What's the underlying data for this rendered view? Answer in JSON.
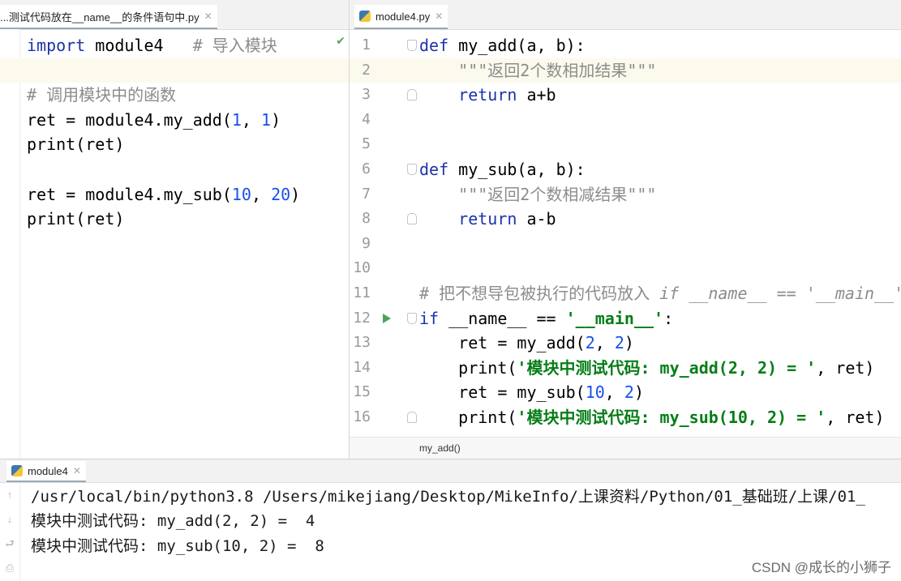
{
  "left_editor": {
    "tab_label": "...测试代码放在__name__的条件语句中.py",
    "lines": [
      {
        "parts": [
          {
            "t": "import",
            "c": "kw"
          },
          {
            "t": " module4   ",
            "c": "fn"
          },
          {
            "t": "# 导入模块",
            "c": "cm"
          }
        ]
      },
      {
        "parts": [],
        "current": true
      },
      {
        "parts": [
          {
            "t": "# 调用模块中的函数",
            "c": "cm"
          }
        ]
      },
      {
        "parts": [
          {
            "t": "ret = module4.my_add(",
            "c": "fn"
          },
          {
            "t": "1",
            "c": "num"
          },
          {
            "t": ", ",
            "c": "fn"
          },
          {
            "t": "1",
            "c": "num"
          },
          {
            "t": ")",
            "c": "fn"
          }
        ]
      },
      {
        "parts": [
          {
            "t": "print",
            "c": "fn"
          },
          {
            "t": "(ret)",
            "c": "fn"
          }
        ]
      },
      {
        "parts": []
      },
      {
        "parts": [
          {
            "t": "ret = module4.my_sub(",
            "c": "fn"
          },
          {
            "t": "10",
            "c": "num"
          },
          {
            "t": ", ",
            "c": "fn"
          },
          {
            "t": "20",
            "c": "num"
          },
          {
            "t": ")",
            "c": "fn"
          }
        ]
      },
      {
        "parts": [
          {
            "t": "print",
            "c": "fn"
          },
          {
            "t": "(ret)",
            "c": "fn"
          }
        ]
      }
    ]
  },
  "right_editor": {
    "tab_label": "module4.py",
    "breadcrumb": "my_add()",
    "lines": [
      {
        "n": "1",
        "fold": "start",
        "parts": [
          {
            "t": "def",
            "c": "kw"
          },
          {
            "t": " my_add(a, b):",
            "c": "fn"
          }
        ]
      },
      {
        "n": "2",
        "current": true,
        "parts": [
          {
            "t": "    ",
            "c": "fn"
          },
          {
            "t": "\"\"\"返回2个数相加结果\"\"\"",
            "c": "doc"
          }
        ]
      },
      {
        "n": "3",
        "fold": "end",
        "parts": [
          {
            "t": "    ",
            "c": "fn"
          },
          {
            "t": "return",
            "c": "kw"
          },
          {
            "t": " a+b",
            "c": "fn"
          }
        ]
      },
      {
        "n": "4",
        "parts": []
      },
      {
        "n": "5",
        "parts": []
      },
      {
        "n": "6",
        "fold": "start",
        "parts": [
          {
            "t": "def",
            "c": "kw"
          },
          {
            "t": " my_sub(a, b):",
            "c": "fn"
          }
        ]
      },
      {
        "n": "7",
        "parts": [
          {
            "t": "    ",
            "c": "fn"
          },
          {
            "t": "\"\"\"返回2个数相减结果\"\"\"",
            "c": "doc"
          }
        ]
      },
      {
        "n": "8",
        "fold": "end",
        "parts": [
          {
            "t": "    ",
            "c": "fn"
          },
          {
            "t": "return",
            "c": "kw"
          },
          {
            "t": " a-b",
            "c": "fn"
          }
        ]
      },
      {
        "n": "9",
        "parts": []
      },
      {
        "n": "10",
        "parts": []
      },
      {
        "n": "11",
        "parts": [
          {
            "t": "# 把不想导包被执行的代码放入 ",
            "c": "cm"
          },
          {
            "t": "if __name__ == '__main__'",
            "c": "cm-i"
          }
        ]
      },
      {
        "n": "12",
        "run": true,
        "fold": "start",
        "parts": [
          {
            "t": "if",
            "c": "kw"
          },
          {
            "t": " __name__ == ",
            "c": "fn"
          },
          {
            "t": "'__main__'",
            "c": "str"
          },
          {
            "t": ":",
            "c": "fn"
          }
        ]
      },
      {
        "n": "13",
        "parts": [
          {
            "t": "    ret = my_add(",
            "c": "fn"
          },
          {
            "t": "2",
            "c": "num"
          },
          {
            "t": ", ",
            "c": "fn"
          },
          {
            "t": "2",
            "c": "num"
          },
          {
            "t": ")",
            "c": "fn"
          }
        ]
      },
      {
        "n": "14",
        "parts": [
          {
            "t": "    print(",
            "c": "fn"
          },
          {
            "t": "'模块中测试代码: my_add(2, 2) = '",
            "c": "str"
          },
          {
            "t": ", ret)",
            "c": "fn"
          }
        ]
      },
      {
        "n": "15",
        "parts": [
          {
            "t": "    ret = my_sub(",
            "c": "fn"
          },
          {
            "t": "10",
            "c": "num"
          },
          {
            "t": ", ",
            "c": "fn"
          },
          {
            "t": "2",
            "c": "num"
          },
          {
            "t": ")",
            "c": "fn"
          }
        ]
      },
      {
        "n": "16",
        "fold": "end",
        "parts": [
          {
            "t": "    print(",
            "c": "fn"
          },
          {
            "t": "'模块中测试代码: my_sub(10, 2) = '",
            "c": "str"
          },
          {
            "t": ", ret)",
            "c": "fn"
          }
        ]
      }
    ]
  },
  "run_panel": {
    "tab_label": "module4",
    "output": [
      "/usr/local/bin/python3.8 /Users/mikejiang/Desktop/MikeInfo/上课资料/Python/01_基础班/上课/01_",
      "模块中测试代码: my_add(2, 2) =  4",
      "模块中测试代码: my_sub(10, 2) =  8"
    ]
  },
  "watermark": "CSDN @成长的小狮子",
  "icons": {
    "python_file": "python-file-icon",
    "close": "close-icon",
    "run": "run-gutter-icon",
    "check": "inspection-ok-icon",
    "up": "up-arrow-icon",
    "down": "down-arrow-icon",
    "wrap": "soft-wrap-icon",
    "print": "print-icon"
  }
}
